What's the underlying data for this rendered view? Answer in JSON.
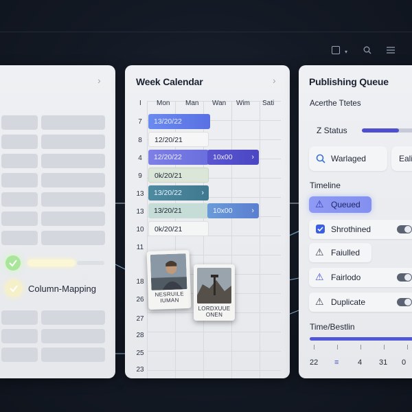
{
  "toolbar": {
    "checkbox_icon": "checkbox-icon",
    "dropdown_caret": "▾",
    "search_icon": "⌕",
    "menu_icon": "☰"
  },
  "left_panel": {
    "chevron": "›",
    "mapping_label": "Column-Mapping"
  },
  "calendar": {
    "title": "Week Calendar",
    "chevron": "›",
    "corner_label": "I",
    "days": [
      "Mon",
      "Man",
      "Wan",
      "Wim",
      "Sati"
    ],
    "rows": [
      "7",
      "8",
      "4",
      "9",
      "13",
      "13",
      "10",
      "11",
      "18",
      "26",
      "27",
      "28",
      "25",
      "23"
    ],
    "events": [
      {
        "label": "13/20/22",
        "arrow": ""
      },
      {
        "label": "12/20/21",
        "arrow": ""
      },
      {
        "label": "12/20/22",
        "arrow": ""
      },
      {
        "label": "10x00",
        "arrow": "›"
      },
      {
        "label": "0k/20/21",
        "arrow": ""
      },
      {
        "label": "13/20/22",
        "arrow": "›"
      },
      {
        "label": "13/20/21",
        "arrow": ""
      },
      {
        "label": "10x00",
        "arrow": "›"
      },
      {
        "label": "0k/20/21",
        "arrow": ""
      }
    ],
    "photos": [
      {
        "caption_line1": "NESRUILE",
        "caption_line2": "IUMAN"
      },
      {
        "caption_line1": "LORDXUUE",
        "caption_line2": "ONEN"
      }
    ]
  },
  "queue": {
    "title": "Publishing Queue",
    "section_label": "Acerthe Ttetes",
    "status_label": "Z Status",
    "status_progress": 0.6,
    "search_label": "Warlaged",
    "search_icon": "search-icon",
    "partial_button": "Eali",
    "timeline_label": "Timeline",
    "items": [
      {
        "label": "Queued",
        "icon": "warning-icon",
        "toggle": false
      },
      {
        "label": "Shrothined",
        "icon": "checkbox-checked-icon",
        "toggle": true
      },
      {
        "label": "Faiulled",
        "icon": "warning-icon",
        "toggle": false
      },
      {
        "label": "Fairlodo",
        "icon": "warning-icon",
        "toggle": true
      },
      {
        "label": "Duplicate",
        "icon": "warning-icon",
        "toggle": true
      }
    ],
    "time_label": "Time/Bestlin",
    "time_progress": 0.85,
    "axis": [
      "22",
      "≡",
      "4",
      "31",
      "0"
    ]
  },
  "colors": {
    "accent": "#4f58d8",
    "accent_light": "#8b93f2",
    "teal": "#4a8195",
    "mint": "#c9dfd8",
    "background": "#141a25"
  }
}
